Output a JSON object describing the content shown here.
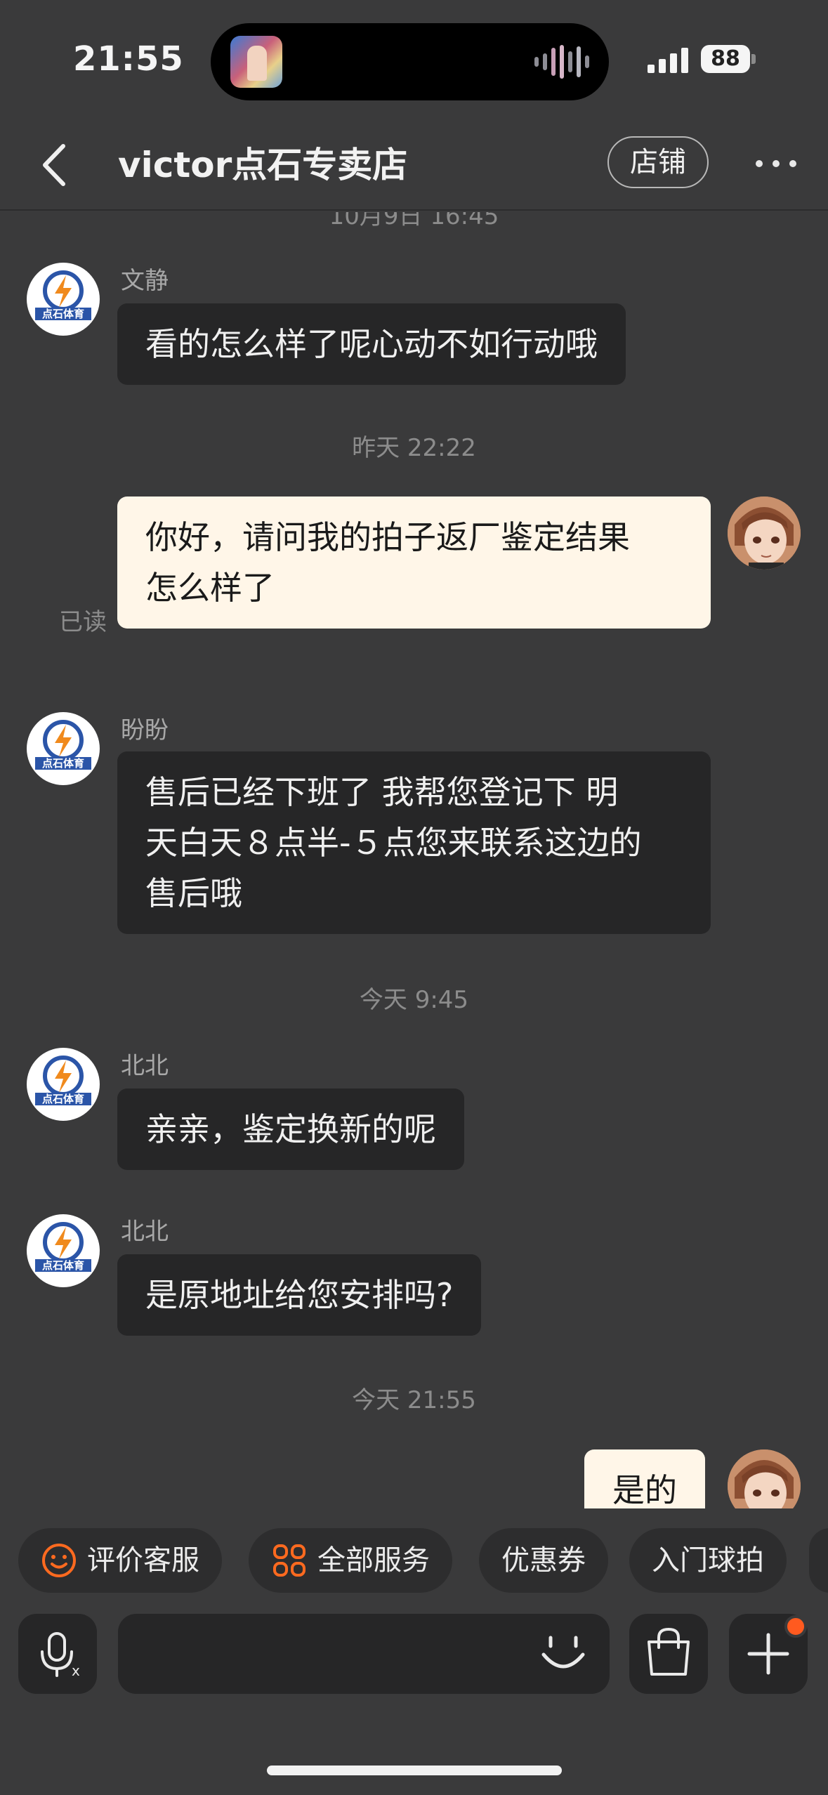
{
  "status_bar": {
    "time": "21:55",
    "battery": "88"
  },
  "header": {
    "title": "victor点石专卖店",
    "shop_button": "店铺"
  },
  "chat": {
    "cut_timestamp": "10月9日 16:45",
    "messages": [
      {
        "sender": "文静",
        "text": "看的怎么样了呢心动不如行动哦"
      },
      {
        "timestamp": "昨天 22:22"
      },
      {
        "mine": true,
        "line1": "你好，请问我的拍子返厂鉴定结果",
        "line2": "怎么样了",
        "read": "已读"
      },
      {
        "sender": "盼盼",
        "line1": "售后已经下班了  我帮您登记下 明",
        "line2": "天白天８点半-５点您来联系这边的",
        "line3": "售后哦"
      },
      {
        "timestamp": "今天 9:45"
      },
      {
        "sender": "北北",
        "text": "亲亲，鉴定换新的呢"
      },
      {
        "sender": "北北",
        "text": "是原地址给您安排吗?"
      },
      {
        "timestamp": "今天 21:55"
      },
      {
        "mine": true,
        "text": "是的"
      }
    ]
  },
  "quick_actions": [
    "评价客服",
    "全部服务",
    "优惠券",
    "入门球拍"
  ],
  "input": {
    "placeholder": ""
  },
  "icons": {
    "avatar_shop": "shop-logo-avatar",
    "avatar_me": "anime-user-avatar",
    "rate": "smile-icon",
    "services": "grid-icon",
    "voice": "microphone-icon",
    "emoji": "emoji-icon",
    "bag": "shopping-bag-icon",
    "plus": "plus-icon"
  },
  "colors": {
    "accent": "#ff5a1f",
    "incoming_bubble": "#262627",
    "outgoing_bubble": "#fff6e8",
    "background": "#3a3a3b"
  }
}
